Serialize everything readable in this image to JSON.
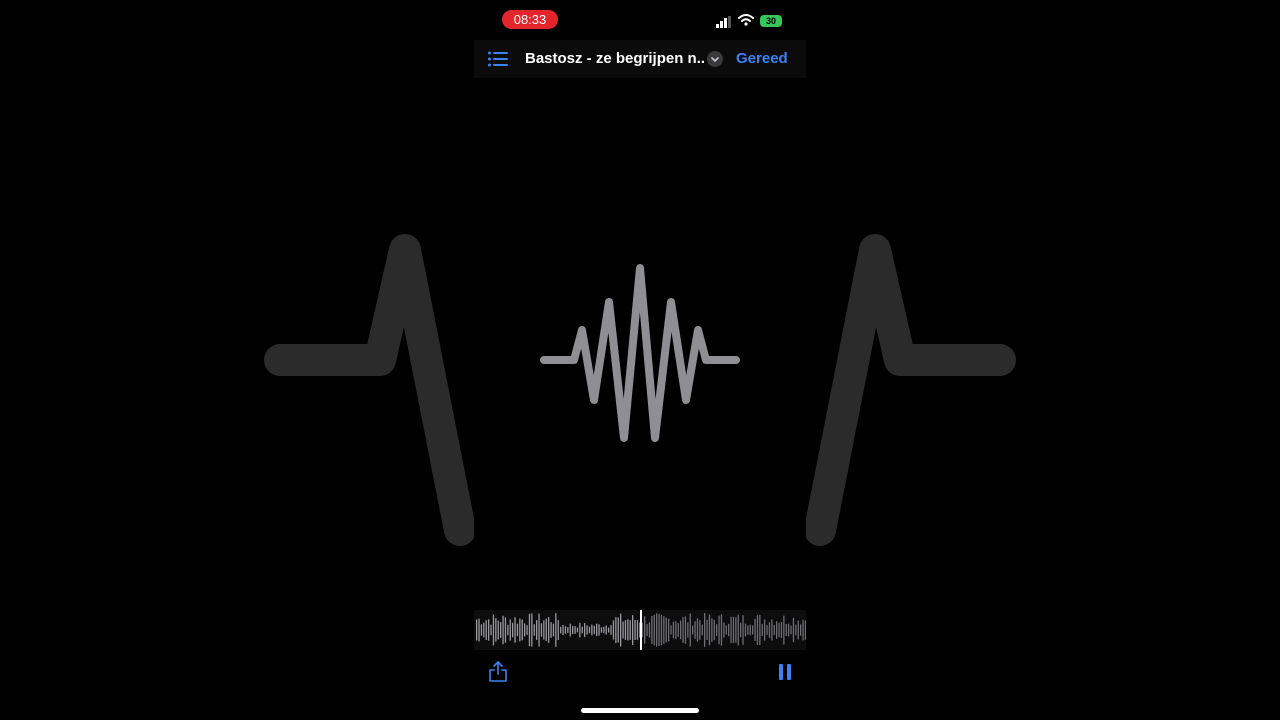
{
  "status_bar": {
    "time": "08:33",
    "battery": "30"
  },
  "header": {
    "title": "Bastosz - ze begrijpen n...",
    "done_label": "Gereed"
  },
  "icons": {
    "list": "list-icon",
    "chevron": "chevron-down-icon",
    "share": "share-icon",
    "pause": "pause-icon",
    "signal": "cellular-signal-icon",
    "wifi": "wifi-icon",
    "battery": "battery-icon"
  },
  "colors": {
    "accent": "#3b82f6",
    "recording_pill": "#e5252c",
    "battery": "#34c759",
    "wave_gray": "#8e8e93"
  }
}
